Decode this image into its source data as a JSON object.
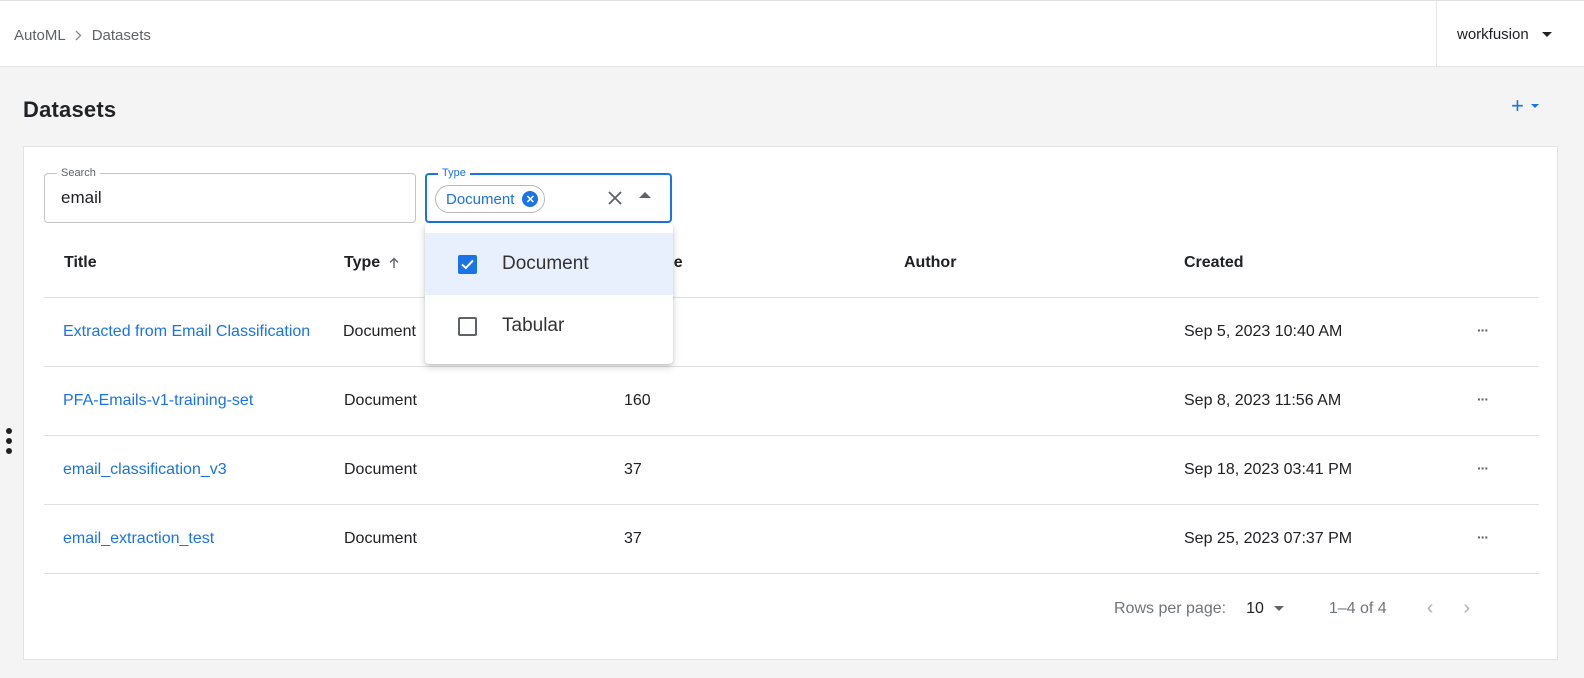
{
  "breadcrumb": {
    "root": "AutoML",
    "current": "Datasets"
  },
  "user": {
    "name": "workfusion"
  },
  "page": {
    "title": "Datasets",
    "add_icon": "plus-icon"
  },
  "search": {
    "label": "Search",
    "value": "email"
  },
  "type_filter": {
    "label": "Type",
    "selected_chip": "Document",
    "options": [
      {
        "label": "Document",
        "checked": true
      },
      {
        "label": "Tabular",
        "checked": false
      }
    ]
  },
  "table": {
    "columns": {
      "title": "Title",
      "type": "Type",
      "volume_partial": "ne",
      "author": "Author",
      "created": "Created"
    },
    "rows": [
      {
        "title": "Extracted from Email Classification",
        "type": "Document",
        "volume": "",
        "author": "",
        "created": "Sep 5, 2023 10:40 AM"
      },
      {
        "title": "PFA-Emails-v1-training-set",
        "type": "Document",
        "volume": "160",
        "author": "",
        "created": "Sep 8, 2023 11:56 AM"
      },
      {
        "title": "email_classification_v3",
        "type": "Document",
        "volume": "37",
        "author": "",
        "created": "Sep 18, 2023 03:41 PM"
      },
      {
        "title": "email_extraction_test",
        "type": "Document",
        "volume": "37",
        "author": "",
        "created": "Sep 25, 2023 07:37 PM"
      }
    ],
    "row_menu": "···"
  },
  "pagination": {
    "rows_per_page_label": "Rows per page:",
    "rows_per_page": "10",
    "range": "1–4 of 4",
    "prev": "‹",
    "next": "›"
  },
  "colors": {
    "accent": "#1a73e8",
    "selected_bg": "#e8f0fe"
  }
}
